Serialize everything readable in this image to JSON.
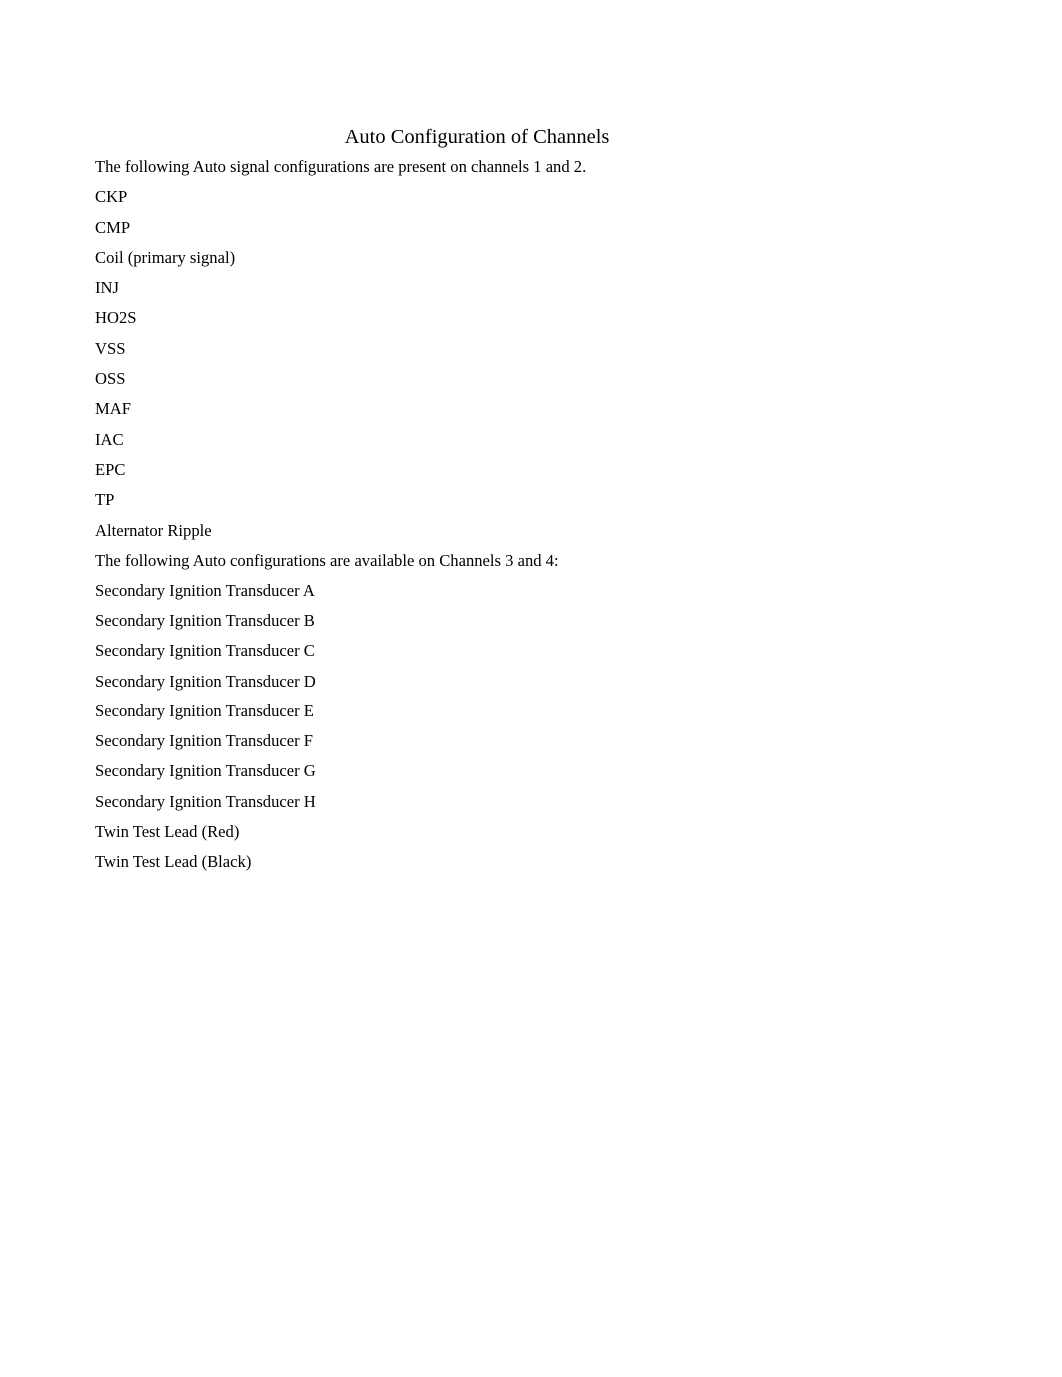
{
  "document": {
    "title": "Auto Configuration of Channels",
    "intro_channels_1_2": "The following Auto signal configurations are present on channels 1 and 2.",
    "channels_1_2_items": [
      "CKP",
      "CMP",
      "Coil (primary signal)",
      "INJ",
      "HO2S",
      "VSS",
      "OSS",
      "MAF",
      "IAC",
      "EPC",
      "TP",
      "Alternator Ripple"
    ],
    "intro_channels_3_4": "The following Auto configurations are available on Channels 3 and 4:",
    "channels_3_4_items": [
      "Secondary Ignition Transducer A",
      "Secondary Ignition Transducer B",
      "Secondary Ignition Transducer C",
      "Secondary Ignition Transducer D",
      "Secondary Ignition Transducer E",
      "Secondary Ignition Transducer F",
      "Secondary Ignition Transducer G",
      "Secondary Ignition Transducer H",
      "Twin Test Lead (Red)",
      "Twin Test Lead (Black)"
    ]
  }
}
